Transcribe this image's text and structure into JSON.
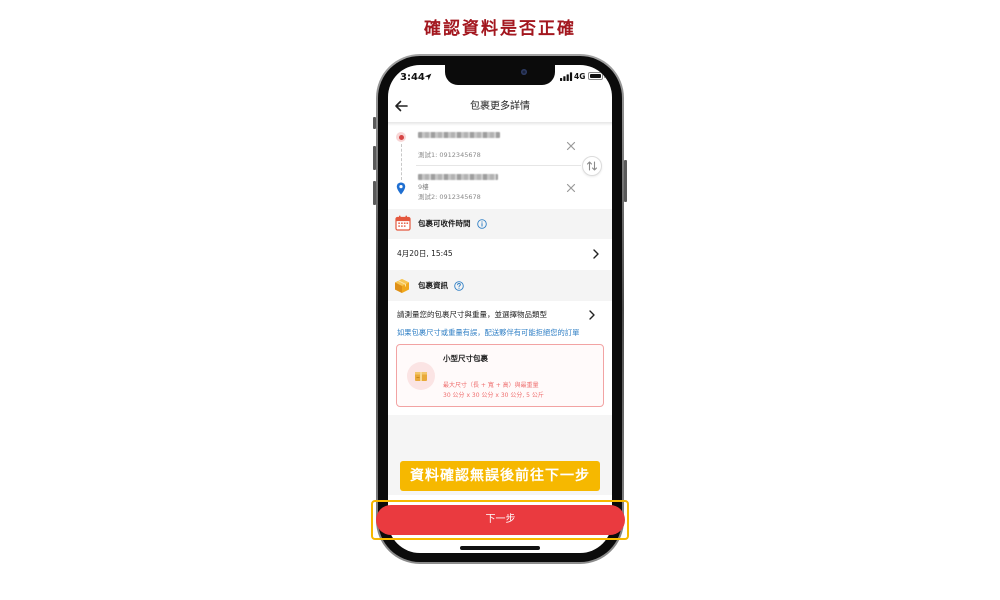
{
  "page": {
    "title": "確認資料是否正確"
  },
  "phone": {
    "status_bar": {
      "time": "3:44",
      "network": "4G"
    },
    "header": {
      "title": "包裹更多詳情"
    },
    "route": {
      "stops": [
        {
          "marker_icon": "pickup-dot-icon",
          "contact": "測試1: 0912345678"
        },
        {
          "marker_icon": "location-pin-icon",
          "floor": "9樓",
          "contact": "測試2: 0912345678"
        }
      ]
    },
    "pickup_time": {
      "section_title": "包裹可收件時間",
      "value": "4月20日, 15:45"
    },
    "package_info": {
      "section_title": "包裹資訊",
      "prompt": "請測量您的包裹尺寸與重量，並選擇物品類型",
      "warning": "如果包裹尺寸或重量有誤，配送夥伴有可能拒絕您的訂單",
      "selected_option": {
        "name": "小型尺寸包裹",
        "limit_label": "最大尺寸（長 + 寬 + 高）與最重量",
        "limit_value": "30 公分 x 30 公分 x 30 公分, 5 公斤"
      }
    },
    "next_button": "下一步"
  },
  "annotation": {
    "callout": "資料確認無誤後前往下一步"
  },
  "icons": [
    "location-arrow-icon",
    "signal-icon",
    "battery-icon",
    "back-arrow-icon",
    "pickup-dot-icon",
    "location-pin-icon",
    "close-icon",
    "swap-icon",
    "calendar-icon",
    "info-icon",
    "chevron-right-icon",
    "box-icon",
    "help-icon",
    "package-icon"
  ],
  "colors": {
    "title": "#a3171f",
    "primary_red": "#ea3a3f",
    "callout_yellow": "#f6b800",
    "link_blue": "#2f7fc5",
    "card_border": "#f2a3a3",
    "card_text": "#ef6e6e",
    "section_bg": "#f4f4f4"
  }
}
